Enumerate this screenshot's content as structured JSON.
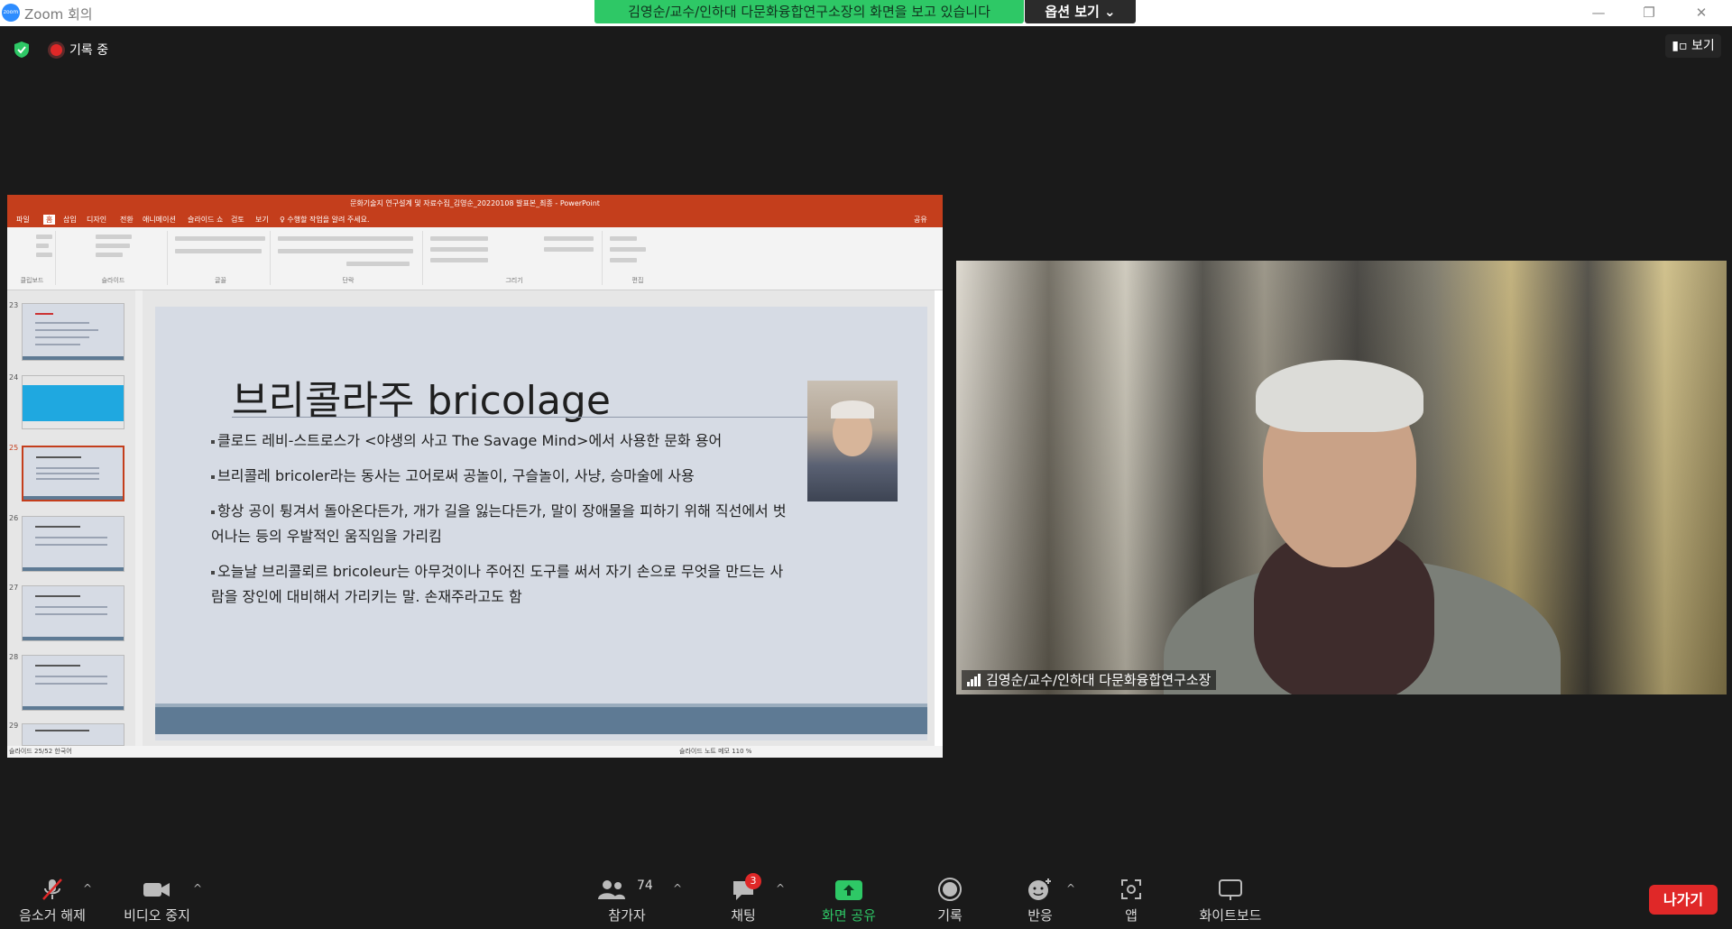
{
  "window": {
    "title": "Zoom 회의",
    "logo_text": "zoom"
  },
  "banner": {
    "text": "김영순/교수/인하대 다문화융합연구소장의 화면을 보고 있습니다",
    "options_label": "옵션 보기 ⌄"
  },
  "status": {
    "recording": "기록 중",
    "view_label": "보기"
  },
  "powerpoint": {
    "title": "문화기술지 연구설계 및 자료수집_김영순_20220108 발표본_최종 - PowerPoint",
    "tabs": [
      "파일",
      "홈",
      "삽입",
      "디자인",
      "전환",
      "애니메이션",
      "슬라이드 쇼",
      "검토",
      "보기",
      "♀ 수행할 작업을 알려 주세요.",
      "공유"
    ],
    "ribbon_groups": [
      "클립보드",
      "슬라이드",
      "글꼴",
      "단락",
      "그리기",
      "편집"
    ],
    "thumb_numbers": [
      "23",
      "24",
      "25",
      "26",
      "27",
      "28",
      "29"
    ],
    "status_left": "슬라이드 25/52   한국어",
    "status_right": "슬라이드 노트   메모        110 %"
  },
  "slide": {
    "title": "브리콜라주 bricolage",
    "bullets": [
      "클로드 레비-스트로스가 <야생의 사고 The Savage Mind>에서 사용한 문화 용어",
      "브리콜레 bricoler라는 동사는 고어로써 공놀이, 구슬놀이, 사냥, 승마술에 사용",
      "항상 공이 튕겨서 돌아온다든가, 개가 길을 잃는다든가, 말이 장애물을 피하기 위해 직선에서 벗어나는 등의 우발적인 움직임을 가리킴",
      "오늘날 브리콜뢰르 bricoleur는 아무것이나 주어진 도구를 써서 자기 손으로 무엇을 만드는 사람을 장인에 대비해서 가리키는 말. 손재주라고도 함"
    ]
  },
  "video": {
    "participant_name": "김영순/교수/인하대 다문화융합연구소장"
  },
  "toolbar": {
    "unmute": "음소거 해제",
    "stop_video": "비디오 중지",
    "participants": "참가자",
    "participants_count": "74",
    "chat": "채팅",
    "chat_badge": "3",
    "share_screen": "화면 공유",
    "record": "기록",
    "reactions": "반응",
    "apps": "앱",
    "whiteboard": "화이트보드",
    "leave": "나가기"
  },
  "colors": {
    "share_green": "#2ec866",
    "leave_red": "#e02828",
    "pp_red": "#c43e1c",
    "slide_bg": "#d6dbe4",
    "slide_band": "#5e7a94"
  }
}
